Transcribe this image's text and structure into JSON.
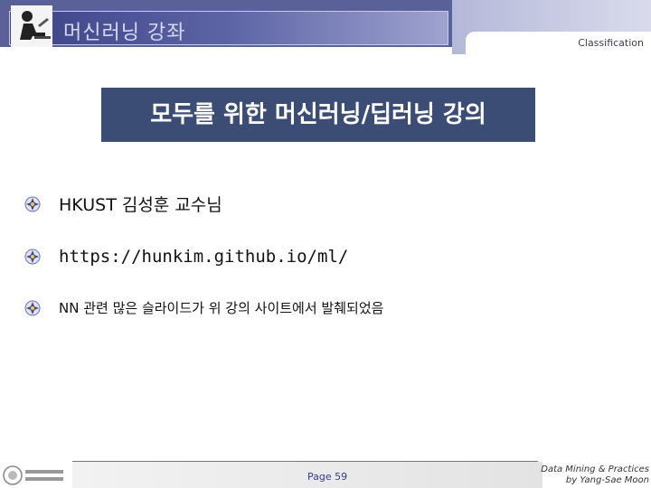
{
  "header": {
    "title": "머신러닝 강좌",
    "classification": "Classification"
  },
  "slide": {
    "title": "모두를 위한 머신러닝/딥러닝 강의",
    "bullets": [
      "HKUST 김성훈 교수님",
      "https://hunkim.github.io/ml/",
      "NN 관련 많은 슬라이드가 위 강의 사이트에서 발췌되었음"
    ]
  },
  "footer": {
    "page": "Page 59",
    "credit_line1": "Data Mining & Practices",
    "credit_line2": "by Yang-Sae Moon"
  },
  "colors": {
    "title_background": "#3b4d74",
    "header_accent": "#5a6199"
  },
  "icons": {
    "header_logo": "person-at-desk-icon",
    "bullet": "flower-bullet-icon",
    "footer_logo": "university-emblem-icon"
  }
}
